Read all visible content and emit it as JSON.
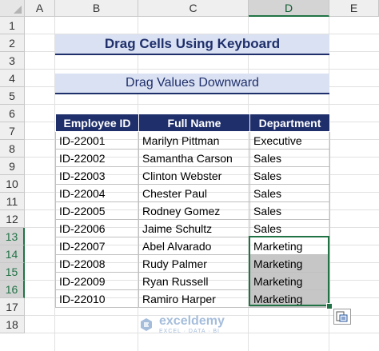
{
  "columns": [
    "A",
    "B",
    "C",
    "D",
    "E"
  ],
  "rows": [
    "1",
    "2",
    "3",
    "4",
    "5",
    "6",
    "7",
    "8",
    "9",
    "10",
    "11",
    "12",
    "13",
    "14",
    "15",
    "16",
    "17",
    "18"
  ],
  "title": "Drag Cells Using Keyboard",
  "subtitle": "Drag Values Downward",
  "table": {
    "headers": [
      "Employee ID",
      "Full Name",
      "Department"
    ],
    "rows": [
      [
        "ID-22001",
        "Marilyn Pittman",
        "Executive"
      ],
      [
        "ID-22002",
        "Samantha Carson",
        "Sales"
      ],
      [
        "ID-22003",
        "Clinton Webster",
        "Sales"
      ],
      [
        "ID-22004",
        "Chester Paul",
        "Sales"
      ],
      [
        "ID-22005",
        "Rodney Gomez",
        "Sales"
      ],
      [
        "ID-22006",
        "Jaime Schultz",
        "Sales"
      ],
      [
        "ID-22007",
        "Abel Alvarado",
        "Marketing"
      ],
      [
        "ID-22008",
        "Rudy Palmer",
        "Marketing"
      ],
      [
        "ID-22009",
        "Ryan Russell",
        "Marketing"
      ],
      [
        "ID-22010",
        "Ramiro Harper",
        "Marketing"
      ]
    ]
  },
  "watermark": {
    "name": "exceldemy",
    "tagline": "EXCEL · DATA · BI",
    "icon": "exceldemy-logo-icon"
  },
  "colors": {
    "accent": "#217346",
    "header_fill": "#1f2f6b",
    "title_fill": "#d9e1f2",
    "selection_fill": "#c6c6c6"
  }
}
